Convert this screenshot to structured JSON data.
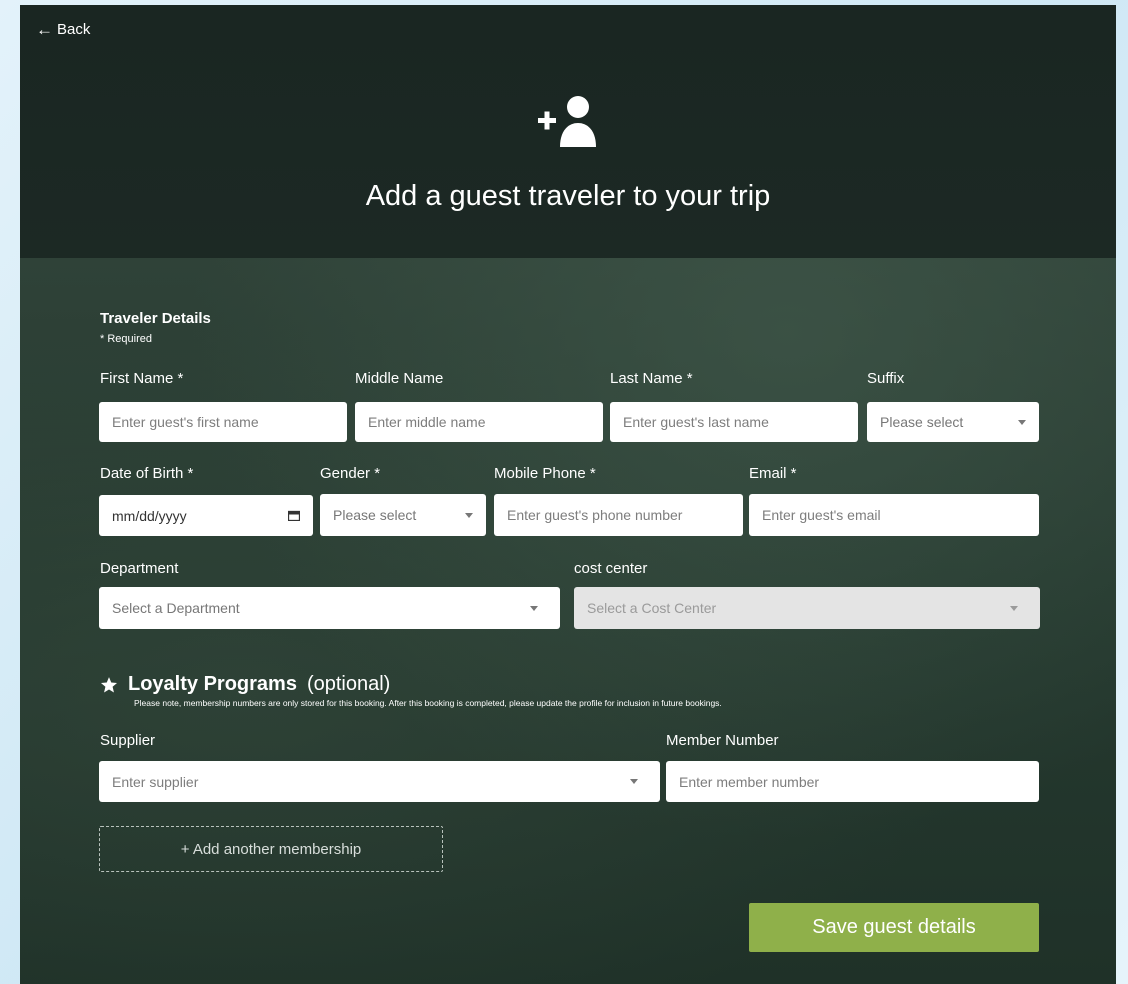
{
  "back": {
    "label": "Back"
  },
  "header": {
    "title": "Add a guest traveler to your trip",
    "icon": "add-user-icon"
  },
  "traveler_details": {
    "title": "Traveler Details",
    "required_note": "* Required",
    "first_name": {
      "label": "First Name *",
      "placeholder": "Enter guest's first name"
    },
    "middle_name": {
      "label": "Middle Name",
      "placeholder": "Enter middle name"
    },
    "last_name": {
      "label": "Last Name *",
      "placeholder": "Enter guest's last name"
    },
    "suffix": {
      "label": "Suffix",
      "value": "Please select"
    },
    "dob": {
      "label": "Date of Birth *",
      "value": "mm/dd/yyyy"
    },
    "gender": {
      "label": "Gender *",
      "value": "Please select"
    },
    "mobile": {
      "label": "Mobile Phone *",
      "placeholder": "Enter guest's phone number"
    },
    "email": {
      "label": "Email *",
      "placeholder": "Enter guest's email"
    },
    "department": {
      "label": "Department",
      "value": "Select a Department"
    },
    "cost_center": {
      "label": "cost center",
      "value": "Select a Cost Center"
    }
  },
  "loyalty": {
    "title": "Loyalty Programs",
    "optional": "(optional)",
    "note": "Please note, membership numbers are only stored for this booking. After this booking is completed, please update the profile for inclusion in future bookings.",
    "supplier": {
      "label": "Supplier",
      "placeholder": "Enter supplier"
    },
    "member_number": {
      "label": "Member Number",
      "placeholder": "Enter member number"
    },
    "add_membership": "+ Add another membership"
  },
  "actions": {
    "save": "Save guest details"
  },
  "colors": {
    "accent": "#8fb04a",
    "panel": "#223029"
  }
}
